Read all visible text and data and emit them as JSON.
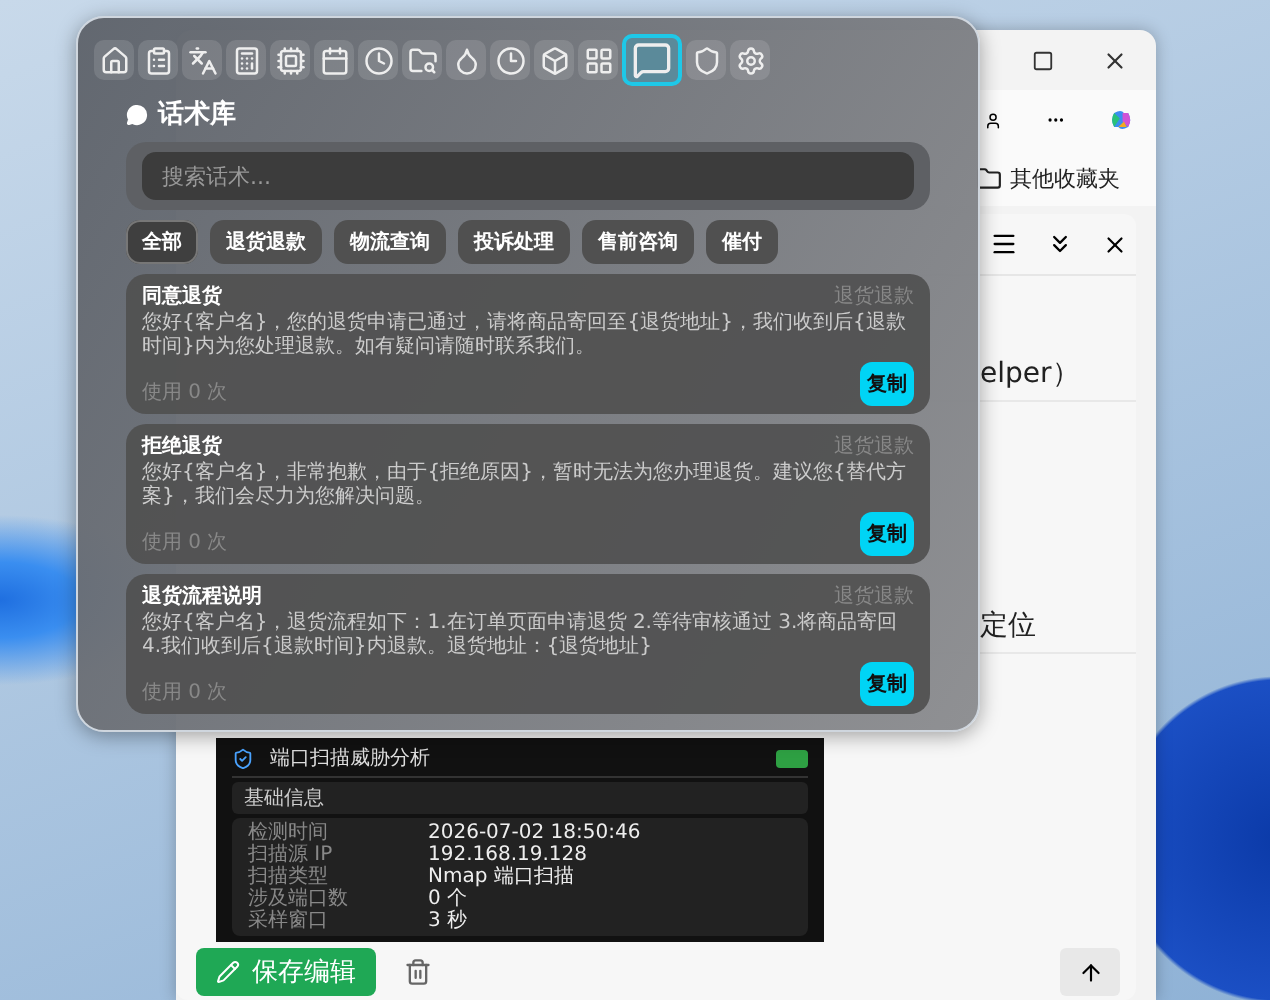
{
  "browser": {
    "bookmarks_folder": "其他收藏夹",
    "side_panel_lines": [
      "elper）",
      "定位"
    ],
    "preview": {
      "title": "端口扫描威胁分析",
      "section": "基础信息",
      "rows": [
        {
          "label": "检测时间",
          "value": "2026-07-02 18:50:46"
        },
        {
          "label": "扫描源 IP",
          "value": "192.168.19.128"
        },
        {
          "label": "扫描类型",
          "value": "Nmap 端口扫描"
        },
        {
          "label": "涉及端口数",
          "value": "0 个"
        },
        {
          "label": "采样窗口",
          "value": "3 秒"
        }
      ]
    },
    "save_button": "保存编辑"
  },
  "panel": {
    "tabs": [
      {
        "selected": false
      },
      {
        "selected": false
      },
      {
        "selected": false
      },
      {
        "selected": false
      },
      {
        "selected": false
      },
      {
        "selected": false
      },
      {
        "selected": false
      },
      {
        "selected": false
      },
      {
        "selected": false
      },
      {
        "selected": false
      },
      {
        "selected": false
      },
      {
        "selected": false
      },
      {
        "selected": true
      },
      {
        "selected": false
      },
      {
        "selected": false
      }
    ],
    "title": "话术库",
    "search": {
      "placeholder": "搜索话术..."
    },
    "filters": [
      {
        "label": "全部",
        "selected": true
      },
      {
        "label": "退货退款",
        "selected": false
      },
      {
        "label": "物流查询",
        "selected": false
      },
      {
        "label": "投诉处理",
        "selected": false
      },
      {
        "label": "售前咨询",
        "selected": false
      },
      {
        "label": "催付",
        "selected": false
      }
    ],
    "cards": [
      {
        "title": "同意退货",
        "category": "退货退款",
        "body": "您好{客户名}，您的退货申请已通过，请将商品寄回至{退货地址}，我们收到后{退款时间}内为您处理退款。如有疑问请随时联系我们。",
        "usage": "使用 0 次",
        "copy": "复制"
      },
      {
        "title": "拒绝退货",
        "category": "退货退款",
        "body": "您好{客户名}，非常抱歉，由于{拒绝原因}，暂时无法为您办理退货。建议您{替代方案}，我们会尽力为您解决问题。",
        "usage": "使用 0 次",
        "copy": "复制"
      },
      {
        "title": "退货流程说明",
        "category": "退货退款",
        "body": "您好{客户名}，退货流程如下：1.在订单页面申请退货 2.等待审核通过 3.将商品寄回 4.我们收到后{退款时间}内退款。退货地址：{退货地址}",
        "usage": "使用 0 次",
        "copy": "复制"
      }
    ]
  }
}
